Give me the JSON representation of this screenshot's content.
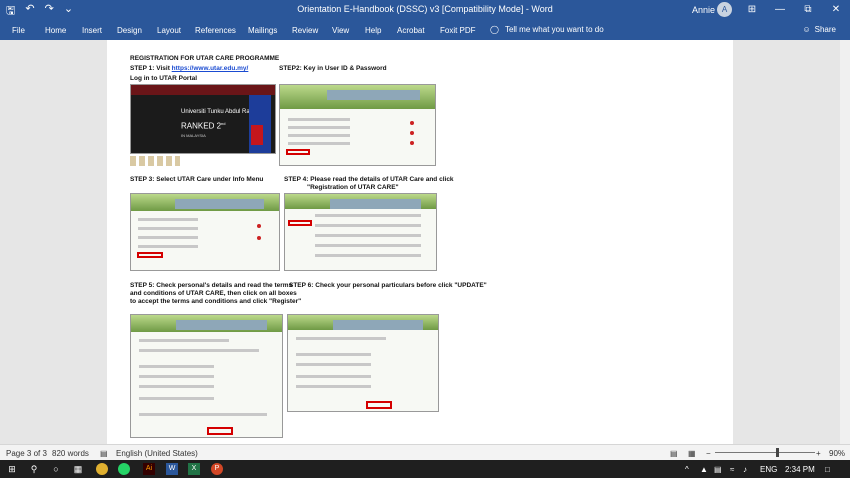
{
  "titlebar": {
    "qat_save": "🖫",
    "qat_undo": "↶",
    "qat_redo": "↷",
    "qat_more": "⌄",
    "title": "Orientation E-Handbook (DSSC) v3 [Compatibility Mode] - Word",
    "user": "Annie",
    "avatar_initial": "A",
    "ribbon_options": "⊞",
    "minimize": "—",
    "restore": "⧉",
    "close": "✕"
  },
  "ribbon": {
    "tabs": [
      "File",
      "Home",
      "Insert",
      "Design",
      "Layout",
      "References",
      "Mailings",
      "Review",
      "View",
      "Help",
      "Acrobat",
      "Foxit PDF"
    ],
    "tell_me": "Tell me what you want to do",
    "share": "Share",
    "bulb_icon": "lightbulb-icon",
    "share_icon": "person-icon"
  },
  "document": {
    "heading": "REGISTRATION FOR UTAR CARE PROGRAMME",
    "step1_prefix": "STEP 1: Visit ",
    "step1_link": "https://www.utar.edu.my/",
    "step1_line2": "Log in to UTAR Portal",
    "step2": "STEP2: Key in User ID & Password",
    "step3": "STEP 3: Select UTAR Care under Info Menu",
    "step4_line1": "STEP 4: Please read the details of UTAR Care and click",
    "step4_line2": "\"Registration of UTAR CARE\"",
    "step5_line1": "STEP 5: Check personal's details and read the terms",
    "step5_line2": "and conditions of UTAR CARE, then click on all boxes",
    "step5_line3": "to accept the terms and conditions and click \"Register\"",
    "step6": "STEP 6: Check your personal particulars before click \"UPDATE\"",
    "utar_home": {
      "university_name": "Universiti Tunku Abdul Rahman",
      "ranked": "RANKED 2",
      "ranked_sup": "nd",
      "in_malaysia": "IN MALAYSIA"
    }
  },
  "statusbar": {
    "page": "Page 3 of 3",
    "words": "820 words",
    "language": "English (United States)",
    "zoom_minus": "−",
    "zoom_plus": "+",
    "zoom": "90%",
    "zoom_level": 0.9
  },
  "taskbar": {
    "start_icon": "⊞",
    "search_icon": "⚲",
    "task_view_icon": "○",
    "apps": [
      "chrome-icon",
      "whatsapp-icon",
      "adobe-illustrator-icon",
      "word-icon",
      "excel-icon",
      "powerpoint-icon"
    ],
    "tray_lang": "ENG",
    "time": "2:34 PM"
  }
}
